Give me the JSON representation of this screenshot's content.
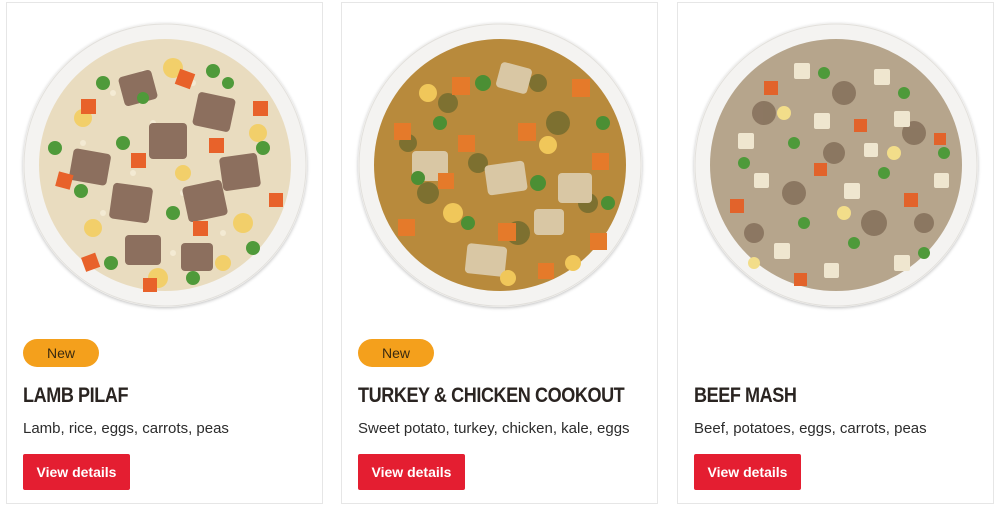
{
  "products": [
    {
      "badge": "New",
      "name": "LAMB PILAF",
      "ingredients": "Lamb, rice, eggs, carrots, peas",
      "cta": "View details",
      "image": "lamb-pilaf-bowl-image"
    },
    {
      "badge": "New",
      "name": "TURKEY & CHICKEN COOKOUT",
      "ingredients": "Sweet potato, turkey, chicken, kale, eggs",
      "cta": "View details",
      "image": "turkey-chicken-cookout-bowl-image"
    },
    {
      "badge": "",
      "name": "BEEF MASH",
      "ingredients": "Beef, potatoes, eggs, carrots, peas",
      "cta": "View details",
      "image": "beef-mash-bowl-image"
    }
  ],
  "colors": {
    "badge": "#f4a01c",
    "button": "#e41e31",
    "title": "#2a2421",
    "border": "#e6e6e6"
  }
}
